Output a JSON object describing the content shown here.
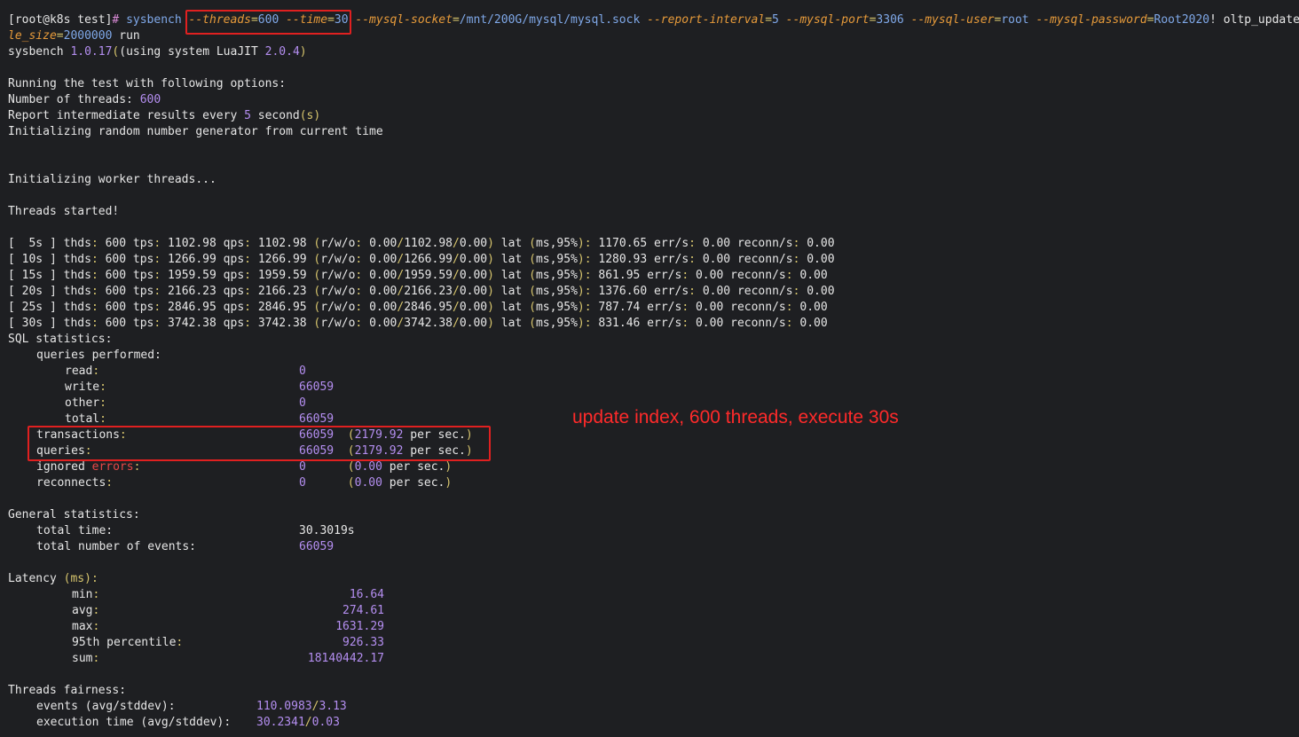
{
  "command": {
    "prompt": "[root@k8s test]",
    "hash": "#",
    "tool": "sysbench",
    "threads_opt": "--threads",
    "threads_val": "600",
    "time_opt": "--time",
    "time_val": "30",
    "socket_opt": "--mysql-socket",
    "socket_val": "/mnt/200G/mysql/mysql.sock",
    "interval_opt": "--report-interval",
    "interval_val": "5",
    "port_opt": "--mysql-port",
    "port_val": "3306",
    "user_opt": "--mysql-user",
    "user_val": "root",
    "password_opt": "--mysql-password",
    "password_val": "Root2020",
    "password_bang": "!",
    "script": "oltp_update_index",
    "cont_opt": "le_size",
    "cont_val": "2000000",
    "cont_run": "run"
  },
  "header": {
    "version_line_a": "sysbench ",
    "version": "1.0.17",
    "version_line_b": " (using system LuaJIT ",
    "luajit": "2.0.4",
    "version_line_c": ")",
    "running": "Running the test with following options:",
    "threads_label": "Number of threads: ",
    "threads_value": "600",
    "report_a": "Report intermediate results every ",
    "report_num": "5",
    "report_b": " second",
    "report_c": "(s)",
    "init_rng": "Initializing random number generator from current time",
    "init_workers": "Initializing worker threads...",
    "started": "Threads started!"
  },
  "intervals": [
    {
      "t": "5s",
      "thds": "600",
      "tps": "1102.98",
      "qps": "1102.98",
      "r": "0.00",
      "w": "1102.98",
      "o": "0.00",
      "lat": "1170.65",
      "err": "0.00",
      "reconn": "0.00"
    },
    {
      "t": "10s",
      "thds": "600",
      "tps": "1266.99",
      "qps": "1266.99",
      "r": "0.00",
      "w": "1266.99",
      "o": "0.00",
      "lat": "1280.93",
      "err": "0.00",
      "reconn": "0.00"
    },
    {
      "t": "15s",
      "thds": "600",
      "tps": "1959.59",
      "qps": "1959.59",
      "r": "0.00",
      "w": "1959.59",
      "o": "0.00",
      "lat": "861.95",
      "err": "0.00",
      "reconn": "0.00"
    },
    {
      "t": "20s",
      "thds": "600",
      "tps": "2166.23",
      "qps": "2166.23",
      "r": "0.00",
      "w": "2166.23",
      "o": "0.00",
      "lat": "1376.60",
      "err": "0.00",
      "reconn": "0.00"
    },
    {
      "t": "25s",
      "thds": "600",
      "tps": "2846.95",
      "qps": "2846.95",
      "r": "0.00",
      "w": "2846.95",
      "o": "0.00",
      "lat": "787.74",
      "err": "0.00",
      "reconn": "0.00"
    },
    {
      "t": "30s",
      "thds": "600",
      "tps": "3742.38",
      "qps": "3742.38",
      "r": "0.00",
      "w": "3742.38",
      "o": "0.00",
      "lat": "831.46",
      "err": "0.00",
      "reconn": "0.00"
    }
  ],
  "sql_stats": {
    "title": "SQL statistics:",
    "queries_performed": "queries performed:",
    "read_label": "read",
    "read_value": "0",
    "write_label": "write",
    "write_value": "66059",
    "other_label": "other",
    "other_value": "0",
    "total_label": "total",
    "total_value": "66059",
    "transactions_label": "transactions",
    "transactions_value": "66059",
    "transactions_rate": "2179.92",
    "queries_label": "queries",
    "queries_value": "66059",
    "queries_rate": "2179.92",
    "ignored_label": "ignored ",
    "errors_word": "errors",
    "ignored_value": "0",
    "ignored_rate": "0.00",
    "reconnects_label": "reconnects",
    "reconnects_value": "0",
    "reconnects_rate": "0.00",
    "per_sec": " per sec."
  },
  "general": {
    "title": "General statistics:",
    "total_time_label": "total time:",
    "total_time_value": "30.3019s",
    "events_label": "total number of events:",
    "events_value": "66059"
  },
  "latency": {
    "title_a": "Latency ",
    "title_b": "(ms)",
    "title_c": ":",
    "min_label": "min",
    "min_value": "16.64",
    "avg_label": "avg",
    "avg_value": "274.61",
    "max_label": "max",
    "max_value": "1631.29",
    "p95_label": "95th percentile",
    "p95_value": "926.33",
    "sum_label": "sum",
    "sum_value": "18140442.17"
  },
  "fairness": {
    "title": "Threads fairness:",
    "events_label": "events (avg/stddev):",
    "events_avg": "110.0983",
    "events_std": "3.13",
    "exec_label": "execution time (avg/stddev):",
    "exec_avg": "30.2341",
    "exec_std": "0.03"
  },
  "annotation": "update index, 600 threads, execute 30s"
}
